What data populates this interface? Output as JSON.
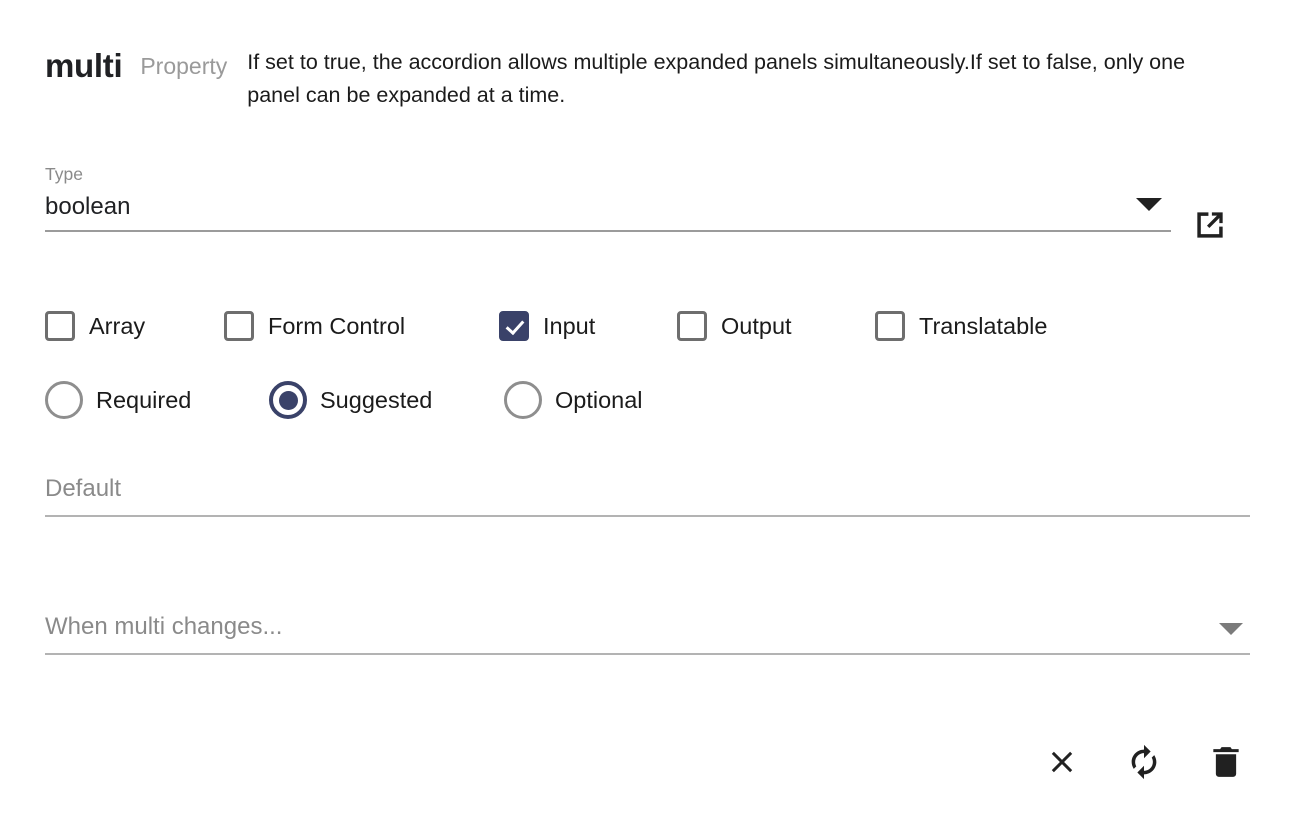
{
  "header": {
    "name": "multi",
    "kind": "Property",
    "description": "If set to true, the accordion allows multiple expanded panels simultaneously.If set to false, only one panel can be expanded at a time."
  },
  "type_field": {
    "label": "Type",
    "value": "boolean",
    "caret_icon": "chevron-down-icon",
    "external_link_icon": "open-in-new-icon"
  },
  "checkboxes": [
    {
      "label": "Array",
      "checked": false
    },
    {
      "label": "Form Control",
      "checked": false
    },
    {
      "label": "Input",
      "checked": true
    },
    {
      "label": "Output",
      "checked": false
    },
    {
      "label": "Translatable",
      "checked": false
    }
  ],
  "radios": [
    {
      "label": "Required",
      "selected": false
    },
    {
      "label": "Suggested",
      "selected": true
    },
    {
      "label": "Optional",
      "selected": false
    }
  ],
  "default_field": {
    "placeholder": "Default",
    "value": ""
  },
  "when_changes_field": {
    "placeholder": "When multi changes...",
    "value": "",
    "caret_icon": "chevron-down-icon"
  },
  "actions": [
    {
      "name": "close",
      "icon": "close-icon",
      "label": "Close"
    },
    {
      "name": "refresh",
      "icon": "sync-icon",
      "label": "Refresh"
    },
    {
      "name": "delete",
      "icon": "trash-icon",
      "label": "Delete"
    }
  ],
  "colors": {
    "accent": "#3a4269",
    "text": "#1b1b1b",
    "muted": "#8a8a8a",
    "rule": "#9b9b9b"
  }
}
